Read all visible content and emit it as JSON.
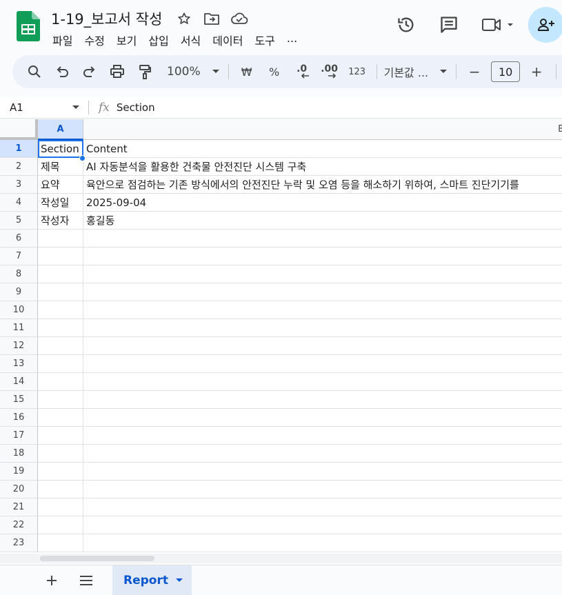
{
  "doc": {
    "title": "1-19_보고서 작성",
    "menu": [
      "파일",
      "수정",
      "보기",
      "삽입",
      "서식",
      "데이터",
      "도구",
      "..."
    ]
  },
  "toolbar": {
    "zoom": "100%",
    "currency": "₩",
    "percent": "%",
    "decrease_decimal": ".0",
    "increase_decimal": ".00",
    "number_format": "123",
    "font": "기본값 ...",
    "font_size": "10",
    "minus": "−",
    "plus": "+"
  },
  "formula_bar": {
    "cell_ref": "A1",
    "fx": "fx",
    "content": "Section"
  },
  "columns": [
    "A",
    "B"
  ],
  "rows": [
    {
      "num": "1",
      "a": "Section",
      "b": "Content"
    },
    {
      "num": "2",
      "a": "제목",
      "b": "AI 자동분석을 활용한 건축물 안전진단 시스템 구축"
    },
    {
      "num": "3",
      "a": "요약",
      "b": "육안으로 점검하는 기존 방식에서의 안전진단 누락 및 오염 등을 해소하기 위하여, 스마트 진단기기를"
    },
    {
      "num": "4",
      "a": "작성일",
      "b": "2025-09-04"
    },
    {
      "num": "5",
      "a": "작성자",
      "b": "홍길동"
    },
    {
      "num": "6",
      "a": "",
      "b": ""
    },
    {
      "num": "7",
      "a": "",
      "b": ""
    },
    {
      "num": "8",
      "a": "",
      "b": ""
    },
    {
      "num": "9",
      "a": "",
      "b": ""
    },
    {
      "num": "10",
      "a": "",
      "b": ""
    },
    {
      "num": "11",
      "a": "",
      "b": ""
    },
    {
      "num": "12",
      "a": "",
      "b": ""
    },
    {
      "num": "13",
      "a": "",
      "b": ""
    },
    {
      "num": "14",
      "a": "",
      "b": ""
    },
    {
      "num": "15",
      "a": "",
      "b": ""
    },
    {
      "num": "16",
      "a": "",
      "b": ""
    },
    {
      "num": "17",
      "a": "",
      "b": ""
    },
    {
      "num": "18",
      "a": "",
      "b": ""
    },
    {
      "num": "19",
      "a": "",
      "b": ""
    },
    {
      "num": "20",
      "a": "",
      "b": ""
    },
    {
      "num": "21",
      "a": "",
      "b": ""
    },
    {
      "num": "22",
      "a": "",
      "b": ""
    },
    {
      "num": "23",
      "a": "",
      "b": ""
    }
  ],
  "sheet_tab": {
    "label": "Report"
  },
  "colors": {
    "accent": "#0b57d0",
    "selection": "#1a73e8",
    "sheets_green": "#0f9d58"
  }
}
